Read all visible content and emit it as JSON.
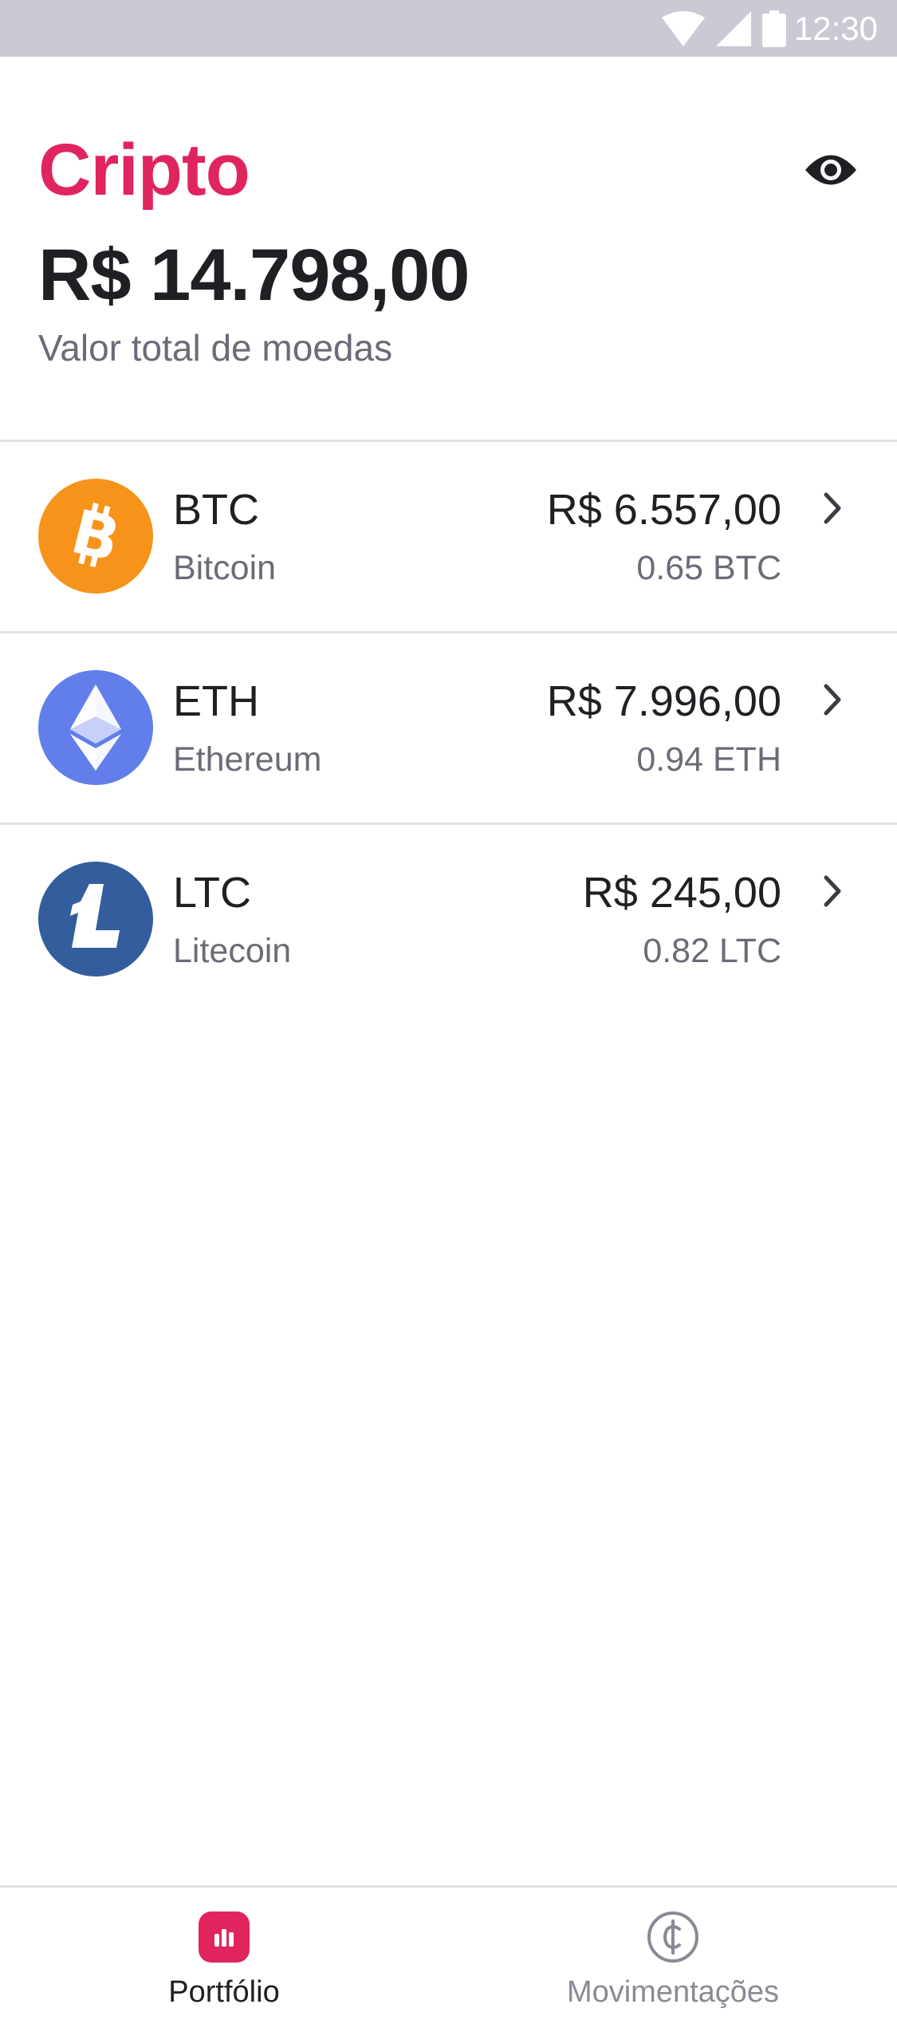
{
  "status_bar": {
    "time": "12:30",
    "icons": [
      "wifi-icon",
      "signal-icon",
      "battery-icon"
    ]
  },
  "header": {
    "title": "Cripto",
    "total_value": "R$ 14.798,00",
    "total_label": "Valor total de moedas",
    "visibility_icon": "eye-icon"
  },
  "coins": [
    {
      "symbol": "BTC",
      "name": "Bitcoin",
      "value": "R$ 6.557,00",
      "amount": "0.65 BTC",
      "icon": "bitcoin-icon",
      "color": "#f7931a"
    },
    {
      "symbol": "ETH",
      "name": "Ethereum",
      "value": "R$ 7.996,00",
      "amount": "0.94 ETH",
      "icon": "ethereum-icon",
      "color": "#627eea"
    },
    {
      "symbol": "LTC",
      "name": "Litecoin",
      "value": "R$ 245,00",
      "amount": "0.82 LTC",
      "icon": "litecoin-icon",
      "color": "#345d9d"
    }
  ],
  "bottom_nav": {
    "tabs": [
      {
        "label": "Portfólio",
        "icon": "chart-bars-icon",
        "active": true
      },
      {
        "label": "Movimentações",
        "icon": "coin-icon",
        "active": false
      }
    ]
  },
  "colors": {
    "accent": "#e0245e",
    "text_primary": "#1f1f24",
    "text_secondary": "#6b6b78",
    "divider": "#e1e1e6",
    "status_bar": "#cacad4"
  }
}
